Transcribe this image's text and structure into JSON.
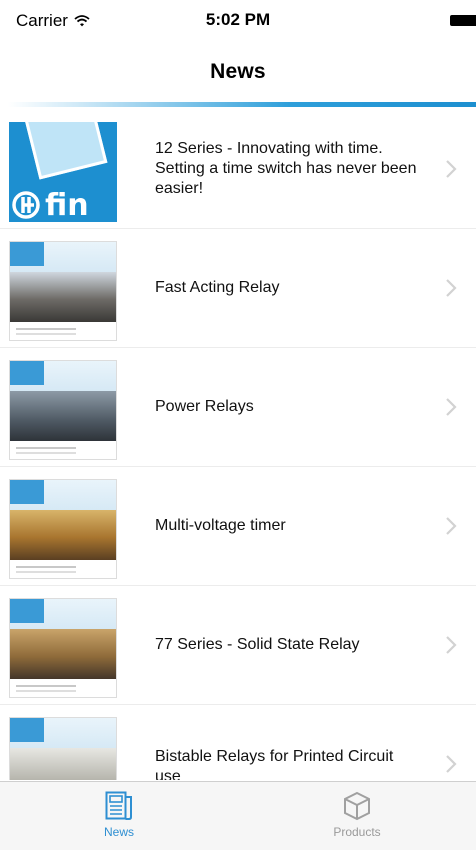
{
  "status_bar": {
    "carrier": "Carrier",
    "time": "5:02 PM"
  },
  "header": {
    "title": "News"
  },
  "news": {
    "items": [
      {
        "title": "12 Series - Innovating with time. Setting a time switch has never been easier!",
        "thumb": "fin-logo"
      },
      {
        "title": "Fast Acting Relay",
        "thumb": "brochure-cover"
      },
      {
        "title": "Power Relays",
        "thumb": "brochure-cover"
      },
      {
        "title": "Multi-voltage timer",
        "thumb": "brochure-cover"
      },
      {
        "title": "77 Series - Solid State Relay",
        "thumb": "brochure-cover"
      },
      {
        "title": "Bistable Relays for Printed Circuit use",
        "thumb": "brochure-cover"
      }
    ],
    "logo_text": "fin"
  },
  "tab_bar": {
    "tabs": [
      {
        "label": "News",
        "icon": "newspaper-icon",
        "selected": true
      },
      {
        "label": "Products",
        "icon": "box-icon",
        "selected": false
      }
    ]
  },
  "colors": {
    "accent": "#2e8fd2",
    "brand": "#1d8fd0",
    "inactive": "#9a9a9a"
  }
}
